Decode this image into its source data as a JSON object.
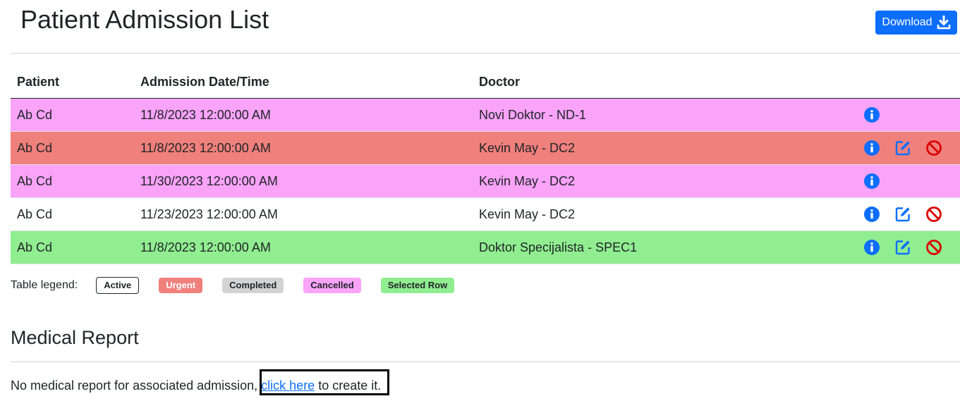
{
  "page": {
    "title": "Patient Admission List",
    "download_label": "Download"
  },
  "table": {
    "headers": [
      "Patient",
      "Admission Date/Time",
      "Doctor"
    ],
    "rows": [
      {
        "patient": "Ab Cd",
        "admission": "11/8/2023 12:00:00 AM",
        "doctor": "Novi Doktor - ND-1",
        "status": "Cancelled",
        "actions": [
          "info"
        ]
      },
      {
        "patient": "Ab Cd",
        "admission": "11/8/2023 12:00:00 AM",
        "doctor": "Kevin May - DC2",
        "status": "Urgent",
        "actions": [
          "info",
          "edit",
          "cancel"
        ]
      },
      {
        "patient": "Ab Cd",
        "admission": "11/30/2023 12:00:00 AM",
        "doctor": "Kevin May - DC2",
        "status": "Cancelled",
        "actions": [
          "info"
        ]
      },
      {
        "patient": "Ab Cd",
        "admission": "11/23/2023 12:00:00 AM",
        "doctor": "Kevin May - DC2",
        "status": "Active",
        "actions": [
          "info",
          "edit",
          "cancel"
        ]
      },
      {
        "patient": "Ab Cd",
        "admission": "11/8/2023 12:00:00 AM",
        "doctor": "Doktor Specijalista - SPEC1",
        "status": "Selected Row",
        "actions": [
          "info",
          "edit",
          "cancel"
        ]
      }
    ]
  },
  "legend": {
    "label": "Table legend:",
    "items": [
      "Active",
      "Urgent",
      "Completed",
      "Cancelled",
      "Selected Row"
    ]
  },
  "medical_report": {
    "title": "Medical Report",
    "text_before": "No medical report for associated admission,",
    "link_text": "click here",
    "text_after": "to create it."
  },
  "icons": {
    "download": "download-icon",
    "info": "info-circle-icon",
    "edit": "edit-icon",
    "cancel": "ban-icon"
  },
  "colors": {
    "primary": "#0d6efd",
    "cancelled": "#f9a3f9",
    "urgent": "#f0807c",
    "completed": "#d3d3d3",
    "selected": "#90ee90",
    "danger": "#dc0000"
  }
}
